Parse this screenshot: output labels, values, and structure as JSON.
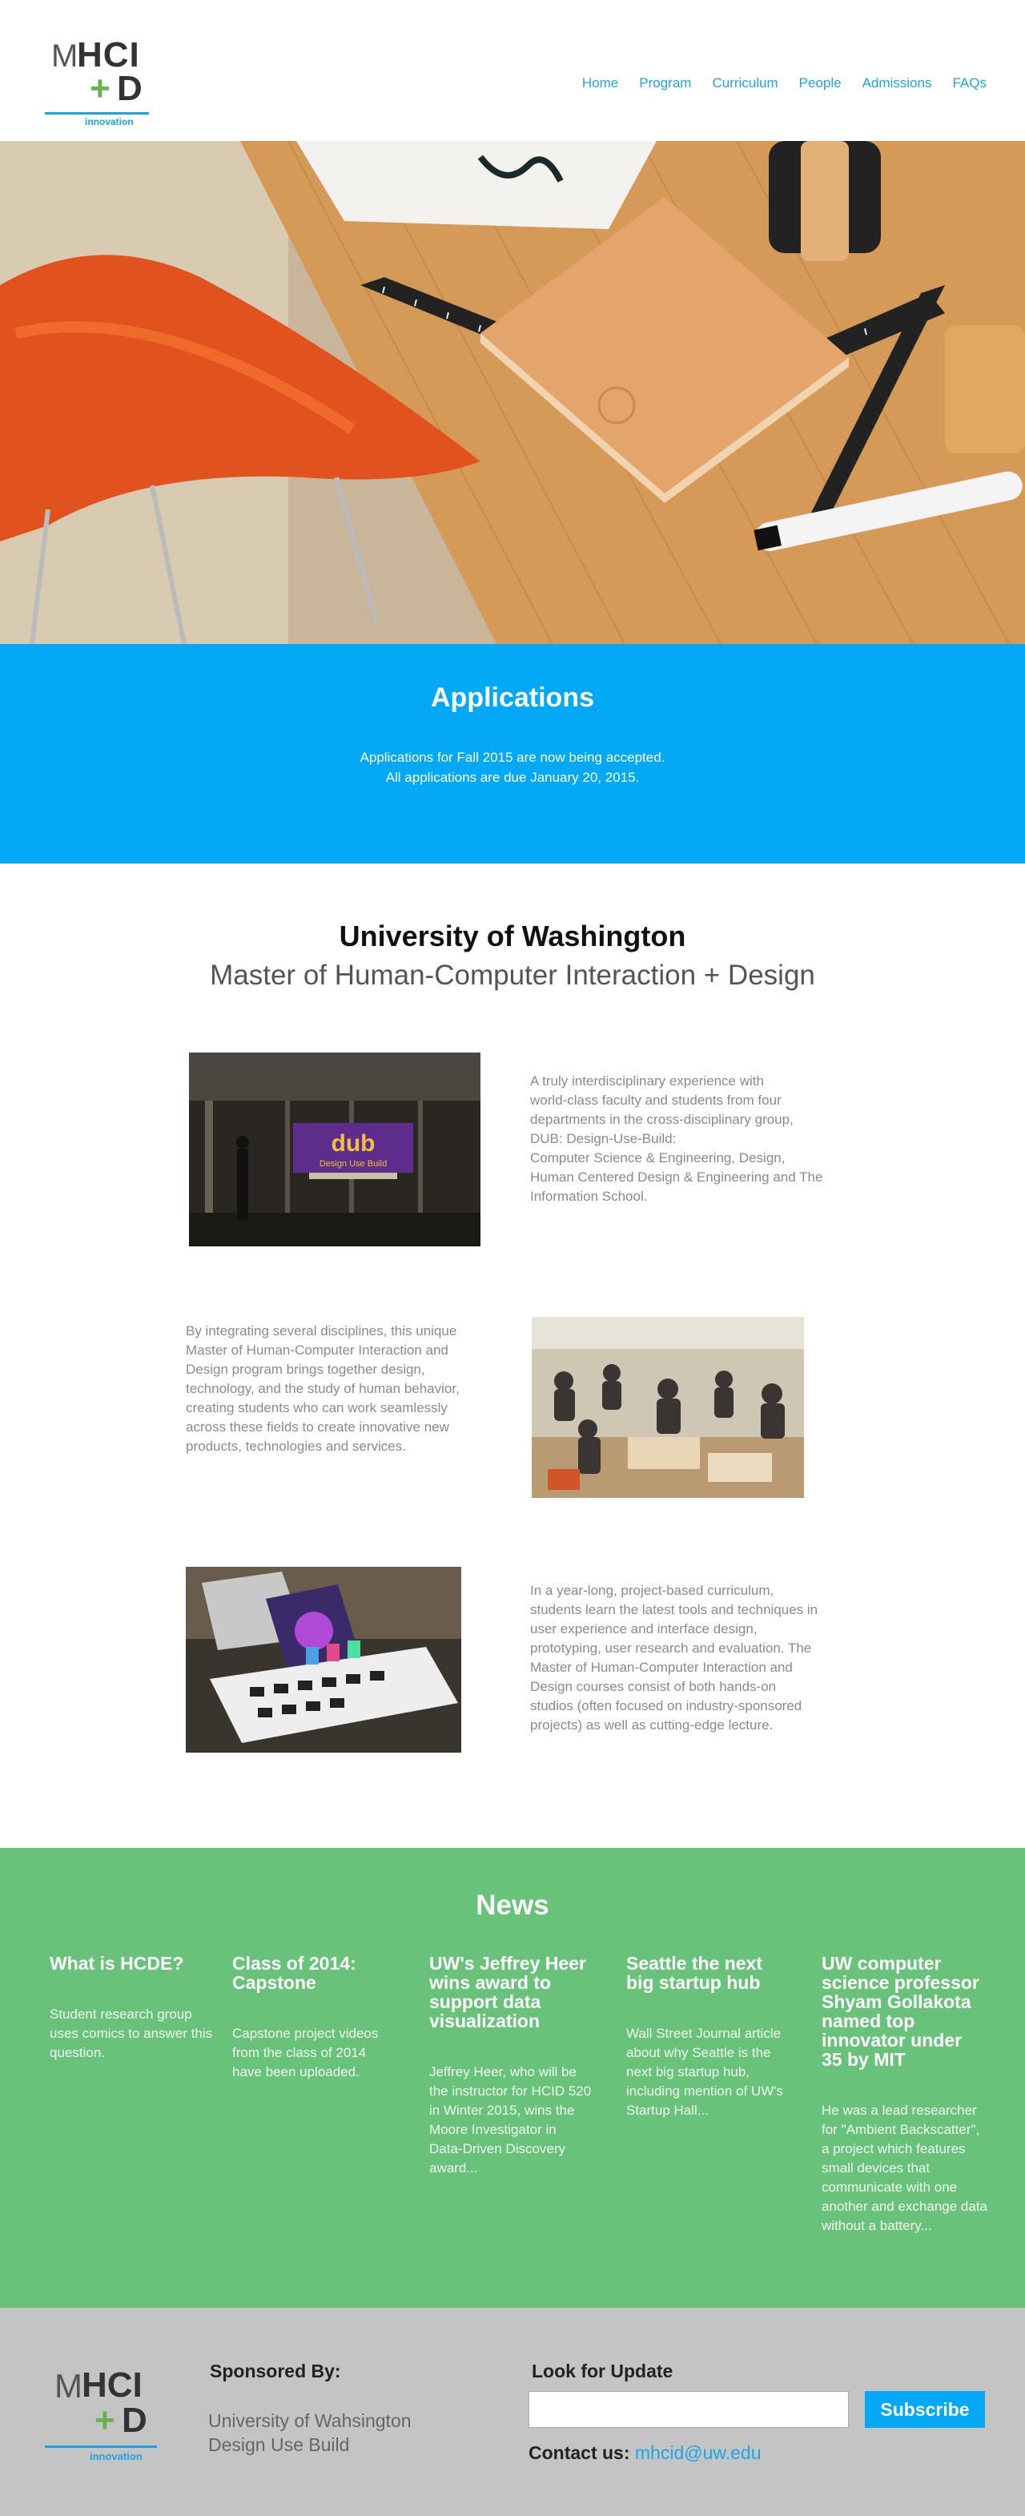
{
  "logo": {
    "m": "M",
    "hci": "HCI",
    "plus": "+",
    "d": "D",
    "tagline": "innovation"
  },
  "nav": {
    "items": [
      "Home",
      "Program",
      "Curriculum",
      "People",
      "Admissions",
      "FAQs"
    ]
  },
  "hero": {
    "image": "desk-with-notebook-and-rulers-photo"
  },
  "applications": {
    "title": "Applications",
    "line1": "Applications for Fall 2015 are now being accepted.",
    "line2": "All applications are due January 20, 2015."
  },
  "intro": {
    "university": "University of Washington",
    "degree": "Master of Human-Computer Interaction + Design",
    "blocks": [
      {
        "image": "dub-design-use-build-sign-photo",
        "lines": [
          "A truly interdisciplinary experience with",
          "world-class faculty and students from four",
          "departments in the cross-disciplinary group,",
          "DUB: Design-Use-Build:",
          "Computer Science & Engineering, Design,",
          "Human Centered Design & Engineering and The",
          "Information School."
        ]
      },
      {
        "image": "students-working-in-studio-photo",
        "lines": [
          "By integrating several disciplines, this unique",
          "Master of Human-Computer Interaction and",
          "Design program brings together design,",
          "technology, and the study of human behavior,",
          "creating students who can work seamlessly",
          "across these fields to create innovative new",
          "products, technologies and services."
        ]
      },
      {
        "image": "prototype-devices-on-table-photo",
        "lines": [
          "In a year-long, project-based curriculum,",
          "students learn the latest tools and techniques in",
          "user experience and interface design,",
          "prototyping, user research and evaluation. The",
          "Master of Human-Computer Interaction and",
          "Design courses consist of both hands-on",
          "studios (often focused on industry-sponsored",
          "projects) as well as cutting-edge lecture."
        ]
      }
    ]
  },
  "news": {
    "title": "News",
    "items": [
      {
        "title_lines": [
          "What is HCDE?"
        ],
        "body_lines": [
          "Student research group",
          "uses comics to answer this",
          "question."
        ]
      },
      {
        "title_lines": [
          "Class of 2014:",
          "Capstone"
        ],
        "body_lines": [
          "Capstone project videos",
          "from the class of 2014",
          "have been uploaded."
        ]
      },
      {
        "title_lines": [
          "UW's Jeffrey Heer",
          "wins award to",
          "support data",
          "visualization"
        ],
        "body_lines": [
          "Jeffrey Heer, who will be",
          "the instructor for HCID 520",
          "in Winter 2015, wins the",
          "Moore Investigator in",
          "Data-Driven Discovery",
          "award..."
        ]
      },
      {
        "title_lines": [
          "Seattle the next",
          "big startup hub"
        ],
        "body_lines": [
          "Wall Street Journal article",
          "about why Seattle is the",
          "next big startup hub,",
          "including mention of UW's",
          "Startup Hall..."
        ]
      },
      {
        "title_lines": [
          "UW computer",
          "science professor",
          "Shyam Gollakota",
          "named top",
          "innovator under",
          "35 by MIT"
        ],
        "body_lines": [
          "He was a lead researcher",
          "for \"Ambient Backscatter\",",
          "a project which features",
          "small devices that",
          "communicate with one",
          "another and exchange data",
          "without a battery..."
        ]
      }
    ]
  },
  "footer": {
    "sponsored_heading": "Sponsored By:",
    "sponsors": [
      "University of Wahsington",
      "Design Use Build"
    ],
    "update_heading": "Look for Update",
    "email_value": "",
    "email_placeholder": "",
    "subscribe_label": "Subscribe",
    "contact_label": "Contact us:",
    "contact_email": "mhcid@uw.edu"
  },
  "colors": {
    "accent_blue": "#03a9f4",
    "link_blue": "#1ea5e6",
    "news_green": "#68c27a",
    "footer_gray": "#c4c4c4",
    "logo_green": "#6ab04c"
  }
}
